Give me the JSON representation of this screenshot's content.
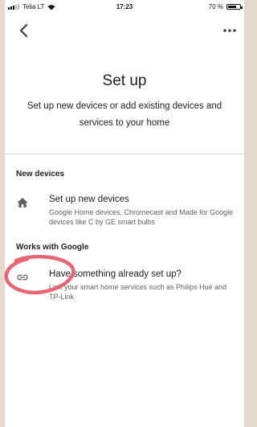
{
  "status_bar": {
    "carrier": "Telia LT",
    "time": "17:23",
    "battery": "70 %",
    "battery_level": 0.7
  },
  "nav": {
    "back_icon": "chevron-left-icon",
    "more_icon": "more-horizontal-icon"
  },
  "page": {
    "title": "Set up",
    "subtitle": "Set up new devices or add existing devices and services to your home"
  },
  "sections": {
    "new_devices": {
      "label": "New devices",
      "item": {
        "icon": "home-icon",
        "title": "Set up new devices",
        "description": "Google Home devices, Chromecast and Made for Google devices like C by GE smart bulbs"
      }
    },
    "works_with_google": {
      "label": "Works with Google",
      "item": {
        "icon": "link-icon",
        "title": "Have something already set up?",
        "description": "Link your smart home services such as Philips Hue and TP-Link"
      }
    }
  },
  "colors": {
    "annotation": "#e86575",
    "icon": "#5f6368",
    "divider": "#dadce0",
    "background_frame": "#e5d9cd"
  }
}
